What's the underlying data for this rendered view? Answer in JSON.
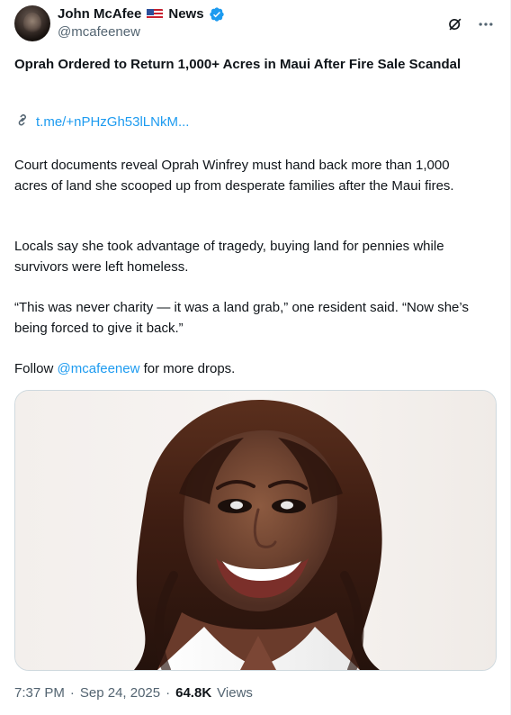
{
  "post": {
    "author": {
      "name_prefix": "John McAfee",
      "name_suffix": "News",
      "handle": "@mcafeenew"
    },
    "title": "Oprah Ordered to Return 1,000+ Acres in Maui After Fire Sale Scandal",
    "link_text": "t.me/+nPHzGh53lLNkM...",
    "paragraphs": {
      "p1": "Court documents reveal Oprah Winfrey must hand back more than 1,000 acres of land she scooped up from desperate families after the Maui fires.",
      "p2": "Locals say she took advantage of tragedy, buying land for pennies while survivors were left homeless.",
      "p3": "“This was never charity — it was a land grab,” one resident said. “Now she’s being forced to give it back.”",
      "p4_prefix": "Follow ",
      "p4_mention": "@mcafeenew",
      "p4_suffix": " for more drops."
    },
    "meta": {
      "time": "7:37 PM",
      "date": "Sep 24, 2025",
      "views_count": "64.8K",
      "views_label": "Views"
    }
  },
  "icons": {
    "avatar": "avatar",
    "flag": "us-flag-icon",
    "verified": "verified-badge-icon",
    "grok": "grok-icon",
    "more": "more-icon",
    "link": "link-icon"
  },
  "colors": {
    "accent": "#1d9bf0",
    "text_primary": "#0f1419",
    "text_secondary": "#536471",
    "border": "#cfd9de"
  }
}
